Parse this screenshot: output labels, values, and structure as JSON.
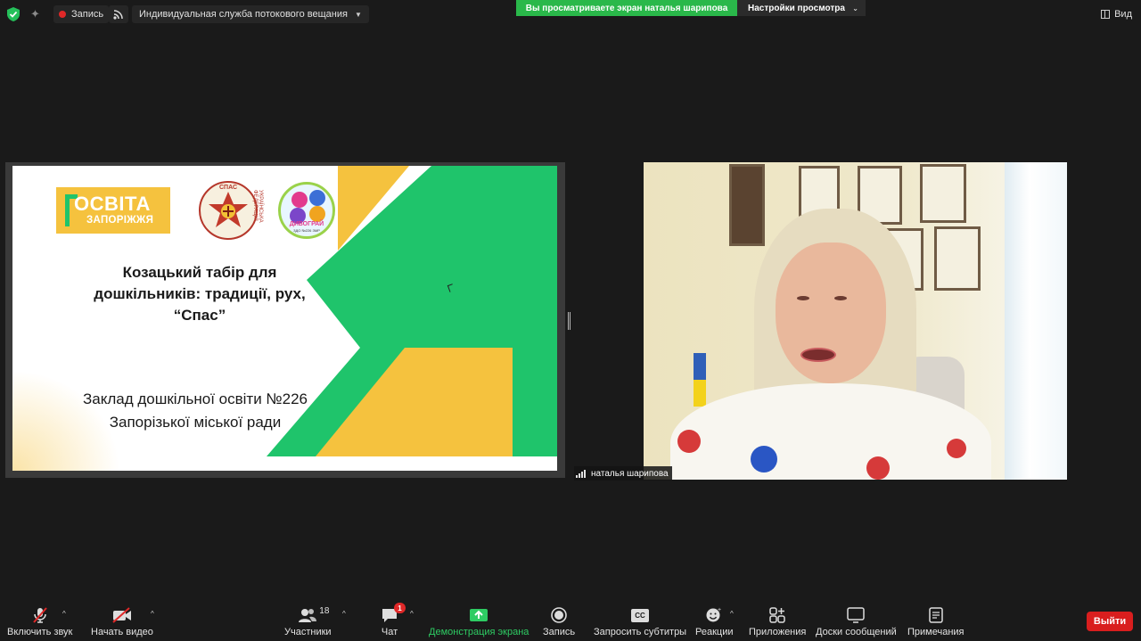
{
  "topbar": {
    "record_label": "Запись",
    "stream_label": "Индивидуальная служба потокового вещания",
    "viewing_banner": "Вы просматриваете экран наталья шарипова",
    "view_settings_label": "Настройки просмотра",
    "view_label": "Вид",
    "icons": [
      "shield-icon",
      "sparkle-icon",
      "record-dot-icon",
      "live-stream-icon",
      "chevron-down-icon",
      "grid-icon"
    ],
    "colors": {
      "banner_green": "#2ab84a",
      "record_red": "#e02828"
    }
  },
  "slide": {
    "logo_osvita_line1": "ОСВІТА",
    "logo_osvita_line2": "ЗАПОРІЖЖЯ",
    "logo_spas_label": "СПАС",
    "logo_spas_side": "УКРАЇНСЬКА ФЕДЕРАЦІЯ",
    "logo_dyvo_label": "ДИВОГРАЙ",
    "logo_dyvo_sub": "ЗДО №226 ЗМР",
    "title_lines": [
      "Козацький табір для",
      "дошкільників: традиції, рух,",
      "“Спас”"
    ],
    "subtitle_lines": [
      "Заклад дошкільної освіти №226",
      "Запорізької міської ради"
    ],
    "colors": {
      "green": "#1fc46b",
      "yellow": "#f5c23e"
    }
  },
  "video": {
    "participant_name": "наталья шарипова"
  },
  "toolbar": {
    "mute_label": "Включить звук",
    "video_label": "Начать видео",
    "participants_label": "Участники",
    "participants_count": "18",
    "chat_label": "Чат",
    "chat_badge": "1",
    "share_label": "Демонстрация экрана",
    "record_label": "Запись",
    "captions_label": "Запросить субтитры",
    "captions_icon_text": "CC",
    "reactions_label": "Реакции",
    "apps_label": "Приложения",
    "whiteboard_label": "Доски сообщений",
    "notes_label": "Примечания",
    "leave_label": "Выйти",
    "icons": [
      "mic-muted-icon",
      "video-off-icon",
      "participants-icon",
      "chat-icon",
      "share-screen-icon",
      "record-icon",
      "cc-icon",
      "reaction-icon",
      "apps-icon",
      "whiteboard-icon",
      "notes-icon"
    ],
    "colors": {
      "share_green": "#2ecc63",
      "leave_red": "#d91e1e"
    }
  }
}
